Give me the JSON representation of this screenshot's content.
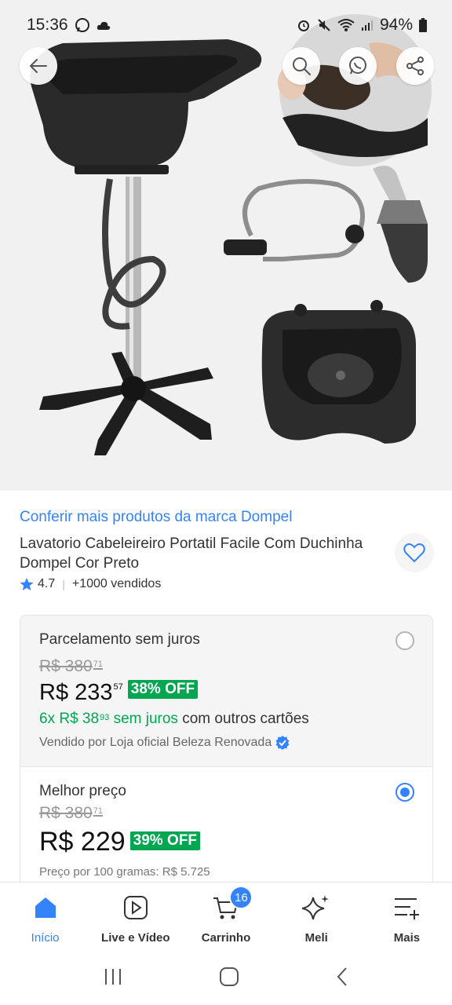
{
  "status_bar": {
    "time": "15:36",
    "battery": "94%"
  },
  "product": {
    "brand_link": "Conferir mais produtos da marca Dompel",
    "title": "Lavatorio Cabeleireiro Portatil Facile Com Duchinha Dompel Cor Preto",
    "rating": "4.7",
    "sold": "+1000 vendidos"
  },
  "offer_installments": {
    "title": "Parcelamento sem juros",
    "old_price": "R$ 380",
    "old_price_cents": "71",
    "price": "R$ 233",
    "price_cents": "57",
    "discount": "38% OFF",
    "installments": "6x R$ 38",
    "installments_cents": "93",
    "installments_suffix": "sem juros",
    "installments_rest": "com outros cartões",
    "seller": "Vendido por Loja oficial Beleza Renovada",
    "selected": false
  },
  "offer_best": {
    "title": "Melhor preço",
    "old_price": "R$ 380",
    "old_price_cents": "71",
    "price": "R$ 229",
    "discount": "39% OFF",
    "unit_price": "Preço por 100 gramas: R$ 5.725",
    "selected": true
  },
  "bottom_nav": {
    "items": [
      {
        "label": "Início",
        "icon": "home-icon",
        "active": true
      },
      {
        "label": "Live e Vídeo",
        "icon": "play-icon"
      },
      {
        "label": "Carrinho",
        "icon": "cart-icon",
        "badge": "16"
      },
      {
        "label": "Meli",
        "icon": "sparkle-icon"
      },
      {
        "label": "Mais",
        "icon": "menu-plus-icon"
      }
    ]
  },
  "colors": {
    "accent": "#3483fa",
    "discount": "#00a650"
  }
}
